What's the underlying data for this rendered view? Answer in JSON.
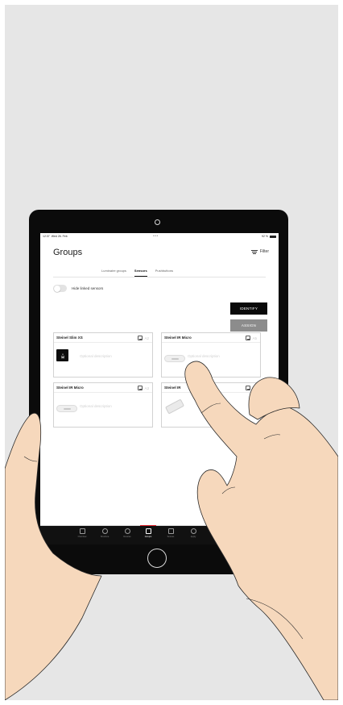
{
  "status_bar": {
    "time": "12:37",
    "date": "Wed 26. Feb",
    "dots": "•••",
    "battery": "92 %"
  },
  "header": {
    "title": "Groups",
    "filter_label": "Filter",
    "filter_icon": "filter-lines-icon"
  },
  "tabs": [
    {
      "label": "Luminaire groups",
      "active": false
    },
    {
      "label": "Sensors",
      "active": true
    },
    {
      "label": "Pushbuttons",
      "active": false
    }
  ],
  "toggle": {
    "label": "Hide linked sensors",
    "on": false
  },
  "actions": {
    "identify": "IDENTIFY",
    "assign": "ASSIGN"
  },
  "sensors": [
    {
      "name": "Steinel Slim XS",
      "description": "Optional description",
      "ghost": "A2",
      "icon": "sensor-black-icon"
    },
    {
      "name": "Steinel IR Micro",
      "description": "Optional description",
      "ghost": "A5",
      "icon": "sensor-pill-icon"
    },
    {
      "name": "Steinel IR Micro",
      "description": "Optional description",
      "ghost": "A3",
      "icon": "sensor-pill-icon"
    },
    {
      "name": "Steinel IR",
      "description": "",
      "ghost": "A4",
      "icon": "sensor-tilted-icon"
    }
  ],
  "bottom_nav": [
    {
      "label": "Overview",
      "icon": "overview-icon",
      "active": false
    },
    {
      "label": "Structure",
      "icon": "layers-icon",
      "active": false
    },
    {
      "label": "Devices",
      "icon": "devices-icon",
      "active": false
    },
    {
      "label": "Groups",
      "icon": "groups-icon",
      "active": true
    },
    {
      "label": "Scenes",
      "icon": "scenes-icon",
      "active": false
    },
    {
      "label": "Apply",
      "icon": "apply-icon",
      "active": false
    }
  ],
  "colors": {
    "accent": "#e0202a",
    "button_dark": "#0a0a0a",
    "button_disabled": "#8c8c8c",
    "skin": "#f6d8bc"
  }
}
